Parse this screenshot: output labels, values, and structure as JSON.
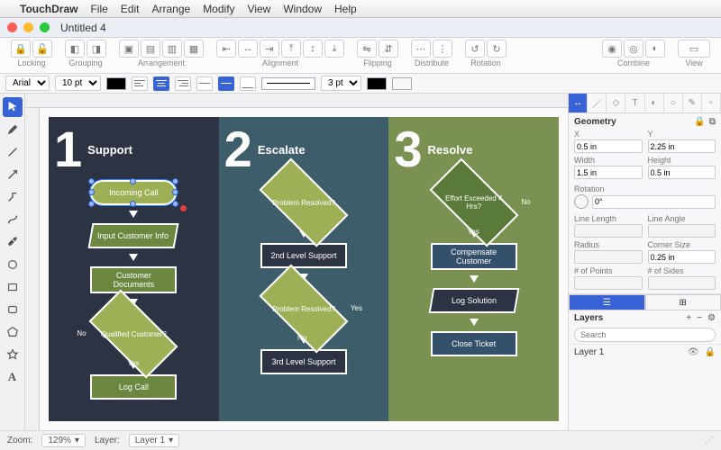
{
  "menubar": {
    "app": "TouchDraw",
    "items": [
      "File",
      "Edit",
      "Arrange",
      "Modify",
      "View",
      "Window",
      "Help"
    ]
  },
  "window": {
    "title": "Untitled 4"
  },
  "toolbar_groups": [
    "Locking",
    "Grouping",
    "Arrangement",
    "Alignment",
    "Flipping",
    "Distribute",
    "Rotation",
    "Combine",
    "View"
  ],
  "optbar": {
    "font": "Arial",
    "size": "10 pt",
    "stroke": "3 pt",
    "fill_color": "#8fad4f",
    "stroke_color": "#000000"
  },
  "inspector": {
    "title": "Geometry",
    "x_label": "X",
    "x": "0.5 in",
    "y_label": "Y",
    "y": "2.25 in",
    "w_label": "Width",
    "w": "1.5 in",
    "h_label": "Height",
    "h": "0.5 in",
    "rot_label": "Rotation",
    "rot": "0°",
    "linelen_label": "Line Length",
    "lineang_label": "Line Angle",
    "radius_label": "Radius",
    "corner_label": "Corner Size",
    "corner": "0.25 in",
    "points_label": "# of Points",
    "sides_label": "# of Sides"
  },
  "layers": {
    "title": "Layers",
    "search_ph": "Search",
    "items": [
      "Layer 1"
    ]
  },
  "status": {
    "zoom_label": "Zoom:",
    "zoom": "129%",
    "layer_label": "Layer:",
    "layer": "Layer 1"
  },
  "flowchart": {
    "cols": [
      {
        "num": "1",
        "title": "Support",
        "nodes": [
          {
            "kind": "terminator",
            "text": "Incoming Call",
            "selected": true
          },
          {
            "kind": "io",
            "text": "Input Customer Info"
          },
          {
            "kind": "process",
            "text": "Customer Documents"
          },
          {
            "kind": "decision",
            "text": "Qualified Customer?",
            "left": "No",
            "down": "Yes"
          },
          {
            "kind": "process",
            "text": "Log Call"
          }
        ]
      },
      {
        "num": "2",
        "title": "Escalate",
        "nodes": [
          {
            "kind": "decision",
            "text": "Problem Resolved?"
          },
          {
            "kind": "process",
            "text": "2nd Level Support"
          },
          {
            "kind": "decision",
            "text": "Problem Resolved?",
            "right": "Yes",
            "down": "No"
          },
          {
            "kind": "process",
            "text": "3rd Level Support"
          }
        ]
      },
      {
        "num": "3",
        "title": "Resolve",
        "nodes": [
          {
            "kind": "decision",
            "text": "Effort Exceeded 4 Hrs?",
            "right": "No",
            "down": "Yes"
          },
          {
            "kind": "process",
            "text": "Compensate Customer"
          },
          {
            "kind": "io",
            "text": "Log Solution",
            "dark": true
          },
          {
            "kind": "process",
            "text": "Close Ticket"
          }
        ]
      }
    ]
  }
}
